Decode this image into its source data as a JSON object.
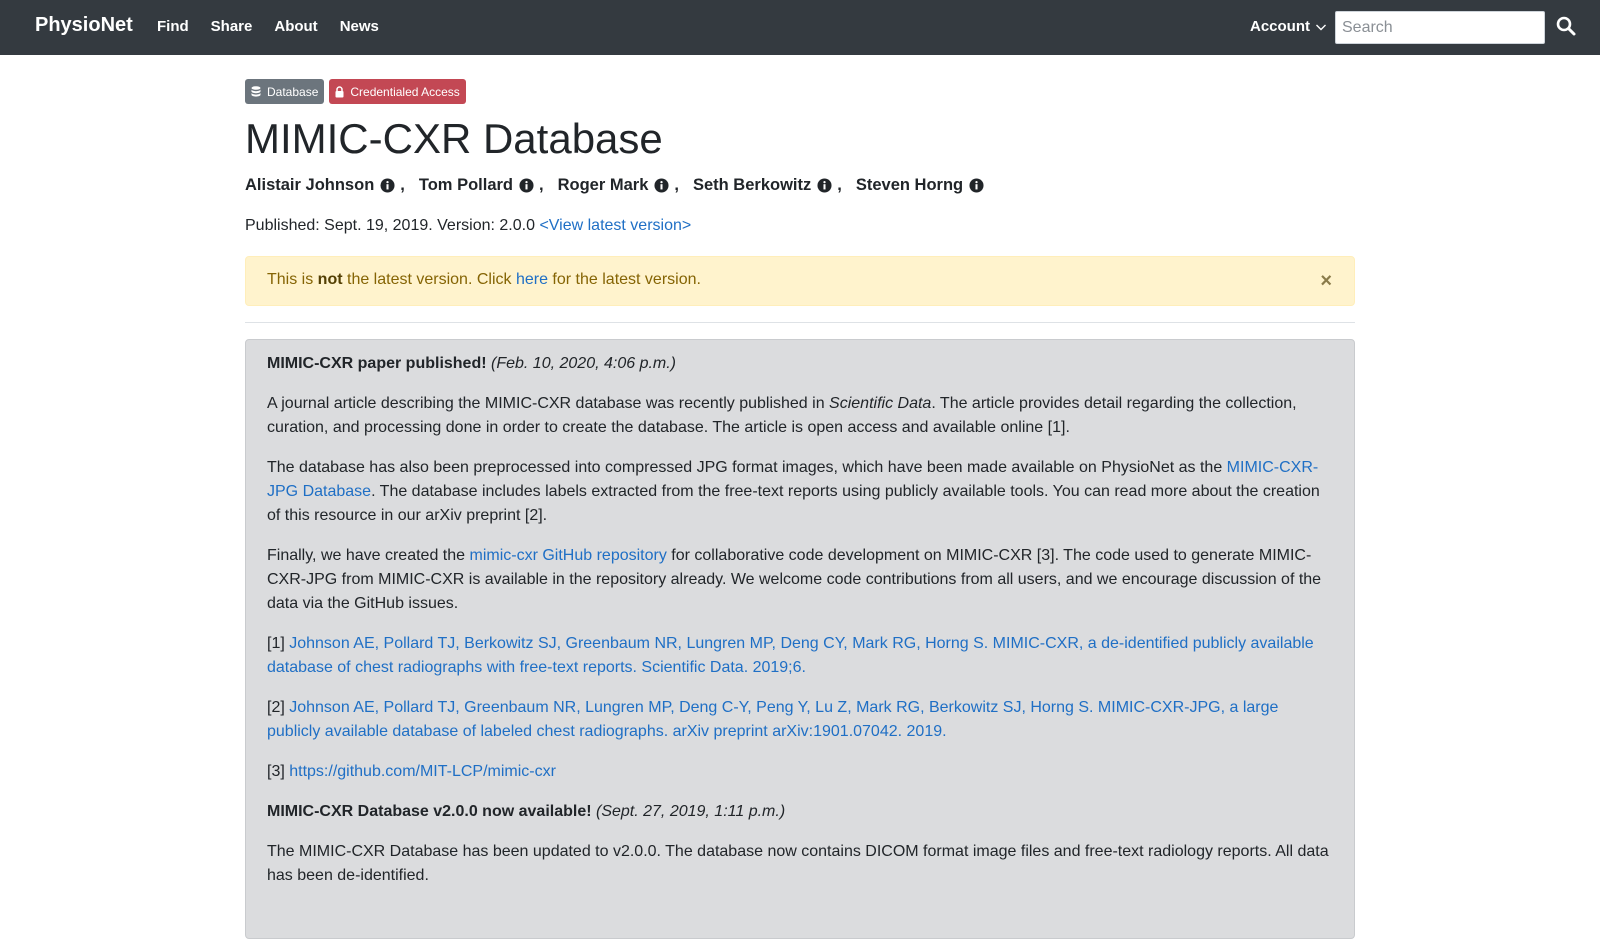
{
  "navbar": {
    "brand": "PhysioNet",
    "links": [
      "Find",
      "Share",
      "About",
      "News"
    ],
    "account_label": "Account",
    "search_placeholder": "Search"
  },
  "badges": {
    "database": "Database",
    "credentialed": "Credentialed Access"
  },
  "project": {
    "title": "MIMIC-CXR Database",
    "authors": [
      "Alistair Johnson",
      "Tom Pollard",
      "Roger Mark",
      "Seth Berkowitz",
      "Steven Horng"
    ],
    "published_text": "Published: Sept. 19, 2019. Version: 2.0.0 ",
    "latest_link": "<View latest version>"
  },
  "alert": {
    "pre": "This is ",
    "bold": "not",
    "mid": " the latest version. Click ",
    "link": "here",
    "post": " for the latest version.",
    "close": "×"
  },
  "news": {
    "item1": {
      "title": "MIMIC-CXR paper published!",
      "date": "(Feb. 10, 2020, 4:06 p.m.)",
      "p1_a": "A journal article describing the MIMIC-CXR database was recently published in ",
      "p1_em": "Scientific Data",
      "p1_b": ". The article provides detail regarding the collection, curation, and processing done in order to create the database. The article is open access and available online [1].",
      "p2_a": "The database has also been preprocessed into compressed JPG format images, which have been made available on PhysioNet as the ",
      "p2_link": "MIMIC-CXR-JPG Database",
      "p2_b": ". The database includes labels extracted from the free-text reports using publicly available tools. You can read more about the creation of this resource in our arXiv preprint [2].",
      "p3_a": "Finally, we have created the ",
      "p3_link": "mimic-cxr GitHub repository",
      "p3_b": " for collaborative code development on MIMIC-CXR [3]. The code used to generate MIMIC-CXR-JPG from MIMIC-CXR is available in the repository already. We welcome code contributions from all users, and we encourage discussion of the data via the GitHub issues.",
      "ref1_label": "[1] ",
      "ref1_link": "Johnson AE, Pollard TJ, Berkowitz SJ, Greenbaum NR, Lungren MP, Deng CY, Mark RG, Horng S. MIMIC-CXR, a de-identified publicly available database of chest radiographs with free-text reports. Scientific Data. 2019;6.",
      "ref2_label": "[2] ",
      "ref2_link": "Johnson AE, Pollard TJ, Greenbaum NR, Lungren MP, Deng C-Y, Peng Y, Lu Z, Mark RG, Berkowitz SJ, Horng S. MIMIC-CXR-JPG, a large publicly available database of labeled chest radiographs. arXiv preprint arXiv:1901.07042. 2019.",
      "ref3_label": "[3] ",
      "ref3_link": "https://github.com/MIT-LCP/mimic-cxr"
    },
    "item2": {
      "title": "MIMIC-CXR Database v2.0.0 now available!",
      "date": "(Sept. 27, 2019, 1:11 p.m.)",
      "p1": "The MIMIC-CXR Database has been updated to v2.0.0. The database now contains DICOM format image files and free-text radiology reports. All data has been de-identified."
    }
  },
  "icons": {
    "search": "search-icon",
    "info": "info-circle-icon",
    "database": "database-icon",
    "lock": "lock-icon",
    "chevron": "chevron-down-icon",
    "close": "close-icon"
  },
  "colors": {
    "navbar_bg": "#343a40",
    "link": "#1f6fc5",
    "alert_bg": "#fff3cd",
    "alert_text": "#856404",
    "badge_database": "#6c757d",
    "badge_credentialed": "#c34854",
    "news_panel_bg": "#dbdcde"
  }
}
